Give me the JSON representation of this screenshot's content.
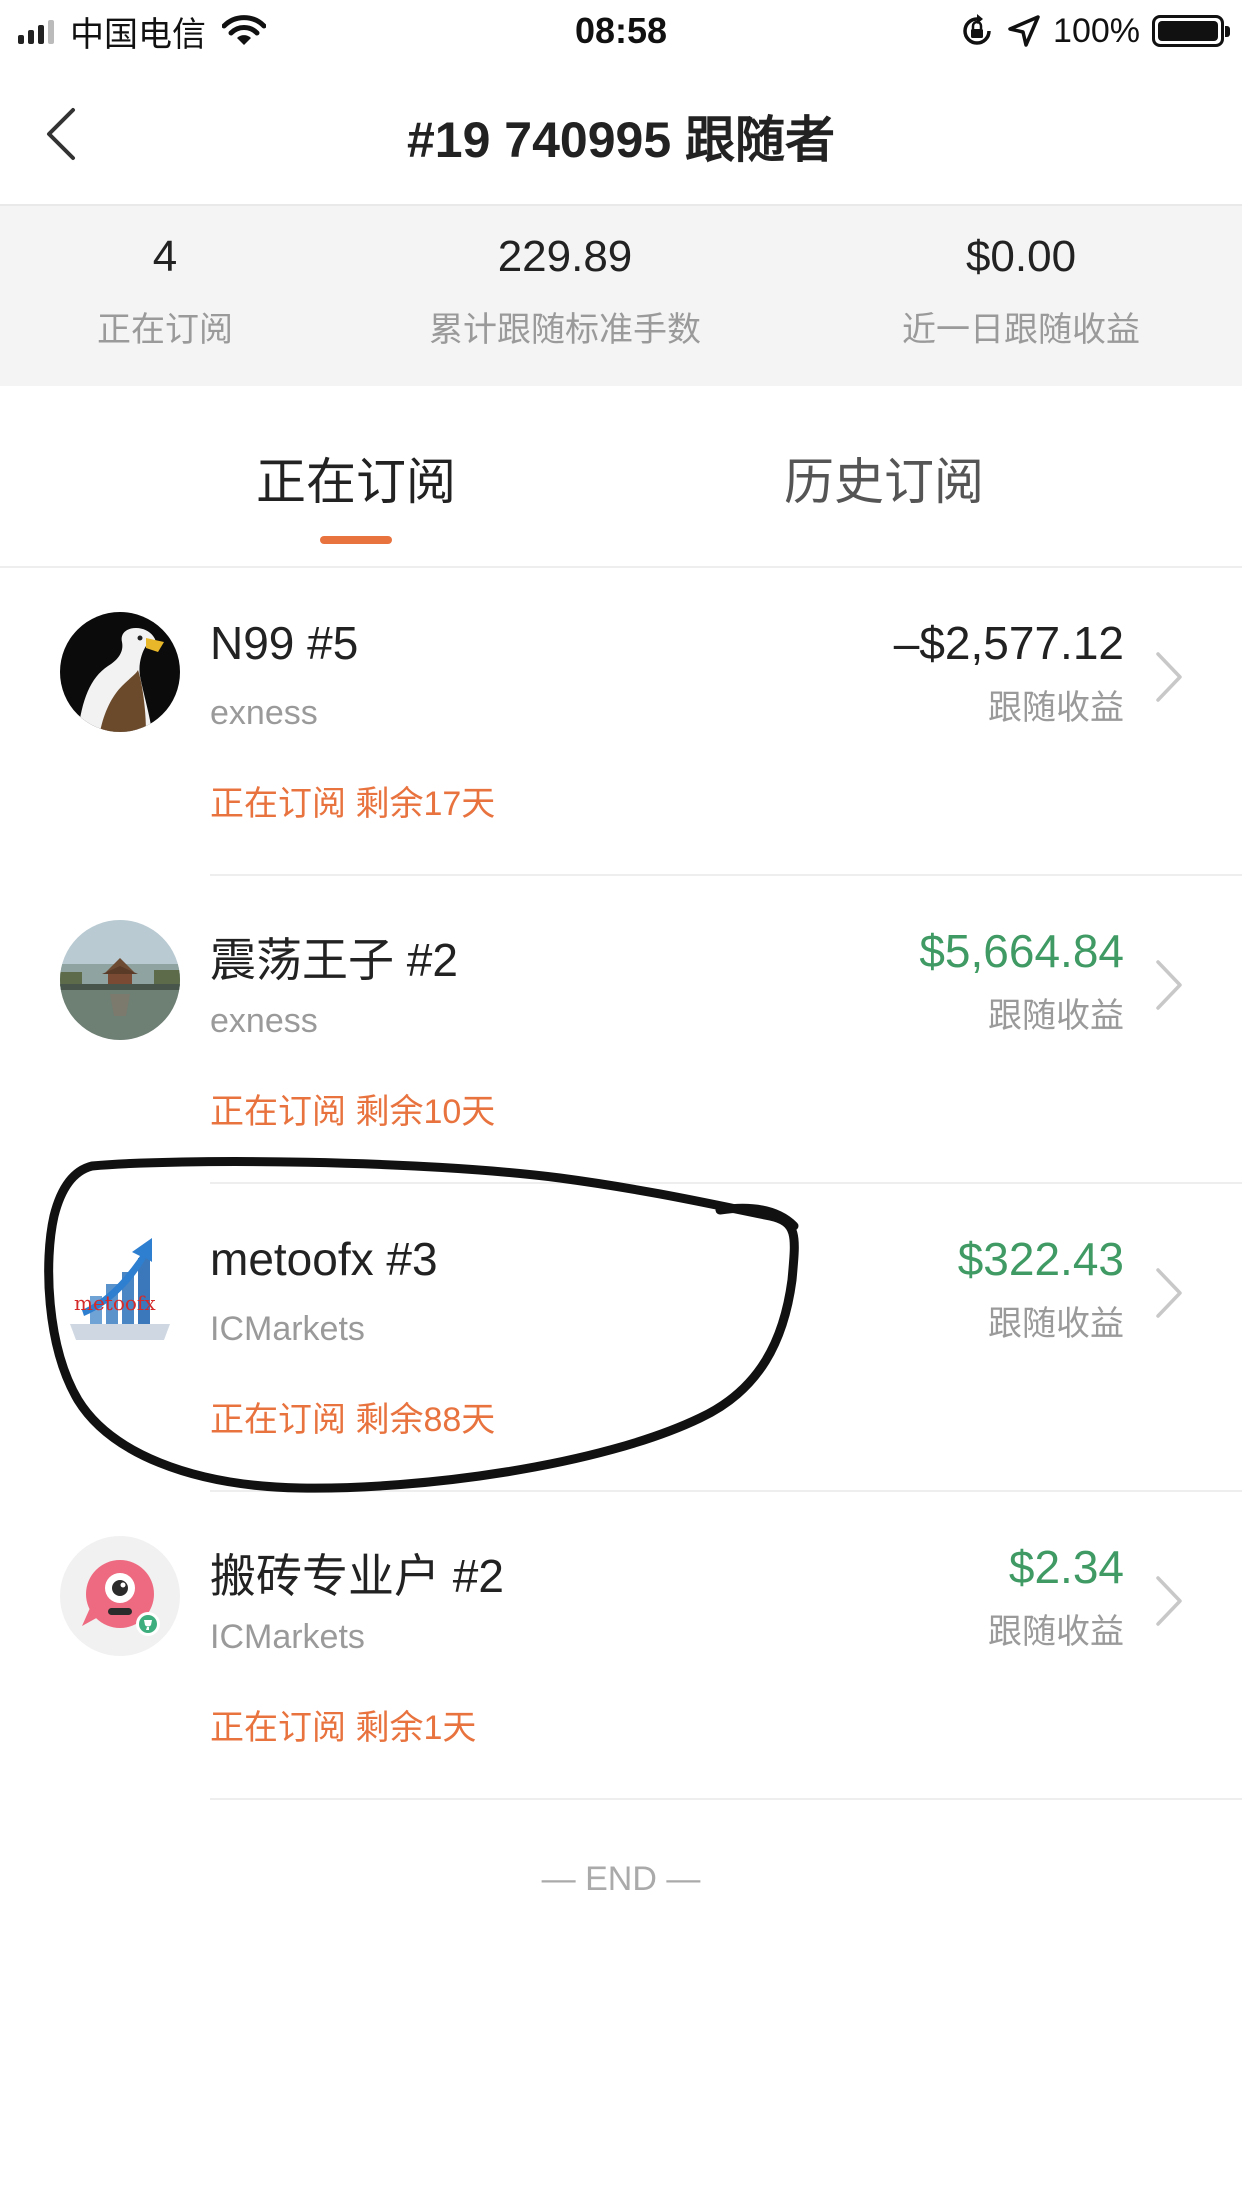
{
  "status_bar": {
    "carrier": "中国电信",
    "time": "08:58",
    "battery": "100%"
  },
  "header": {
    "title": "#19 740995 跟随者"
  },
  "stats": [
    {
      "value": "4",
      "label": "正在订阅"
    },
    {
      "value": "229.89",
      "label": "累计跟随标准手数"
    },
    {
      "value": "$0.00",
      "label": "近一日跟随收益"
    }
  ],
  "tabs": [
    {
      "label": "正在订阅",
      "active": true
    },
    {
      "label": "历史订阅",
      "active": false
    }
  ],
  "subscriptions": [
    {
      "name": "N99 #5",
      "broker": "exness",
      "status": "正在订阅 剩余17天",
      "amount": "–$2,577.12",
      "amount_label": "跟随收益",
      "amount_color": "#222222"
    },
    {
      "name": "震荡王子 #2",
      "broker": "exness",
      "status": "正在订阅 剩余10天",
      "amount": "$5,664.84",
      "amount_label": "跟随收益",
      "amount_color": "#3f9a64"
    },
    {
      "name": "metoofx #3",
      "broker": "ICMarkets",
      "status": "正在订阅 剩余88天",
      "amount": "$322.43",
      "amount_label": "跟随收益",
      "amount_color": "#3f9a64",
      "avatar_text": "metoofx"
    },
    {
      "name": "搬砖专业户 #2",
      "broker": "ICMarkets",
      "status": "正在订阅 剩余1天",
      "amount": "$2.34",
      "amount_label": "跟随收益",
      "amount_color": "#3f9a64"
    }
  ],
  "footer": {
    "end_text": "— END —"
  },
  "colors": {
    "accent": "#e8733f",
    "positive": "#3f9a64"
  }
}
